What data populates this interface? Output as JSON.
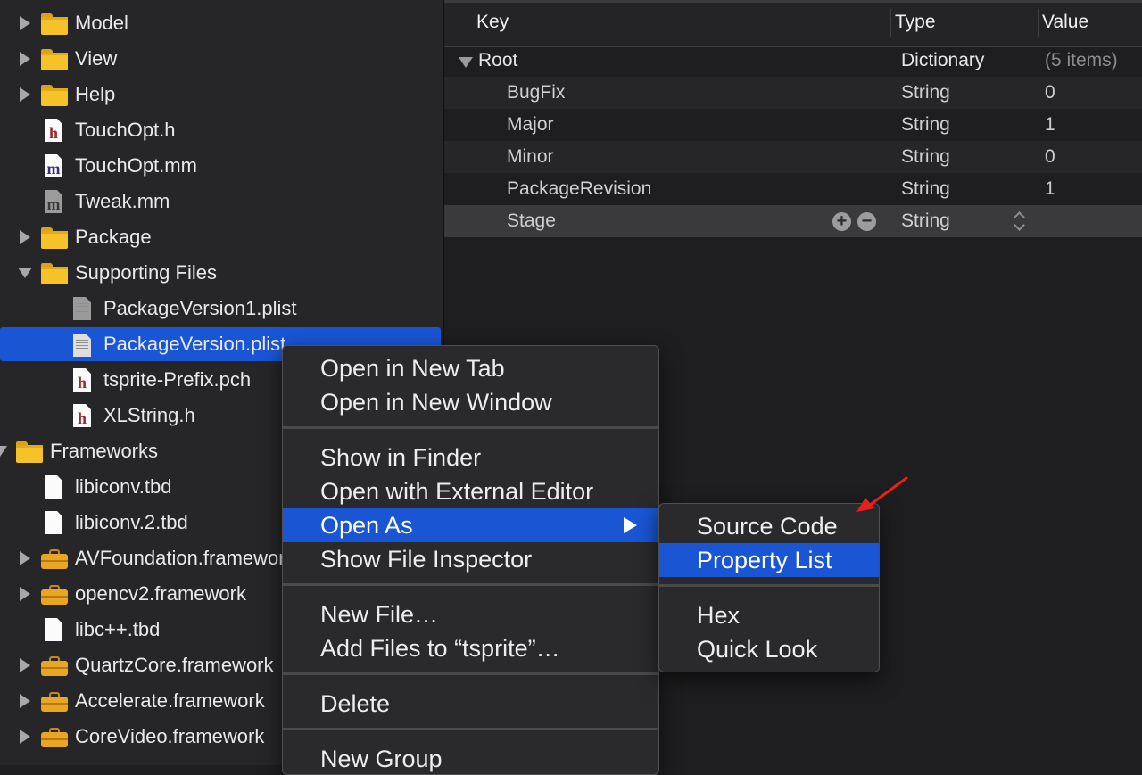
{
  "navigator": {
    "items": [
      {
        "label": "Model",
        "icon": "folder-icon",
        "disclosure": "right",
        "indent": 0
      },
      {
        "label": "View",
        "icon": "folder-icon",
        "disclosure": "right",
        "indent": 0
      },
      {
        "label": "Help",
        "icon": "folder-icon",
        "disclosure": "right",
        "indent": 0
      },
      {
        "label": "TouchOpt.h",
        "icon": "header-file-icon",
        "glyph": "h",
        "indent": 0
      },
      {
        "label": "TouchOpt.mm",
        "icon": "objc-file-icon",
        "glyph": "m",
        "indent": 0
      },
      {
        "label": "Tweak.mm",
        "icon": "objc-file-icon",
        "glyph": "m",
        "indent": 0
      },
      {
        "label": "Package",
        "icon": "folder-icon",
        "disclosure": "right",
        "indent": 0
      },
      {
        "label": "Supporting Files",
        "icon": "folder-icon",
        "disclosure": "down",
        "indent": 0
      },
      {
        "label": "PackageVersion1.plist",
        "icon": "plist-file-icon",
        "indent": 1
      },
      {
        "label": "PackageVersion.plist",
        "icon": "plist-file-icon",
        "indent": 1,
        "selected": true
      },
      {
        "label": "tsprite-Prefix.pch",
        "icon": "header-file-icon",
        "glyph": "h",
        "indent": 1
      },
      {
        "label": "XLString.h",
        "icon": "header-file-icon",
        "glyph": "h",
        "indent": 1
      },
      {
        "label": "Frameworks",
        "icon": "folder-icon",
        "disclosure": "down",
        "indent": -1
      },
      {
        "label": "libiconv.tbd",
        "icon": "file-icon",
        "indent": 0
      },
      {
        "label": "libiconv.2.tbd",
        "icon": "file-icon",
        "indent": 0
      },
      {
        "label": "AVFoundation.framework",
        "icon": "framework-icon",
        "disclosure": "right",
        "indent": 0
      },
      {
        "label": "opencv2.framework",
        "icon": "framework-icon",
        "disclosure": "right",
        "indent": 0
      },
      {
        "label": "libc++.tbd",
        "icon": "file-icon",
        "indent": 0
      },
      {
        "label": "QuartzCore.framework",
        "icon": "framework-icon",
        "disclosure": "right",
        "indent": 0
      },
      {
        "label": "Accelerate.framework",
        "icon": "framework-icon",
        "disclosure": "right",
        "indent": 0
      },
      {
        "label": "CoreVideo.framework",
        "icon": "framework-icon",
        "disclosure": "right",
        "indent": 0
      }
    ]
  },
  "editor": {
    "columns": {
      "key": "Key",
      "type": "Type",
      "value": "Value"
    },
    "root": {
      "key": "Root",
      "type": "Dictionary",
      "value": "(5 items)"
    },
    "rows": [
      {
        "key": "BugFix",
        "type": "String",
        "value": "0"
      },
      {
        "key": "Major",
        "type": "String",
        "value": "1"
      },
      {
        "key": "Minor",
        "type": "String",
        "value": "0"
      },
      {
        "key": "PackageRevision",
        "type": "String",
        "value": "1"
      },
      {
        "key": "Stage",
        "type": "String",
        "value": ""
      }
    ],
    "add_glyph": "+",
    "remove_glyph": "−"
  },
  "context_menu": {
    "groups": [
      [
        "Open in New Tab",
        "Open in New Window"
      ],
      [
        "Show in Finder",
        "Open with External Editor",
        "Open As",
        "Show File Inspector"
      ],
      [
        "New File…",
        "Add Files to “tsprite”…"
      ],
      [
        "Delete"
      ],
      [
        "New Group"
      ]
    ],
    "highlighted": "Open As"
  },
  "submenu": {
    "groups": [
      [
        "Source Code",
        "Property List"
      ],
      [
        "Hex",
        "Quick Look"
      ]
    ],
    "highlighted": "Property List"
  },
  "colors": {
    "selection": "#1a55d4",
    "annotation_arrow": "#e8201c",
    "folder": "#f5c22a"
  }
}
